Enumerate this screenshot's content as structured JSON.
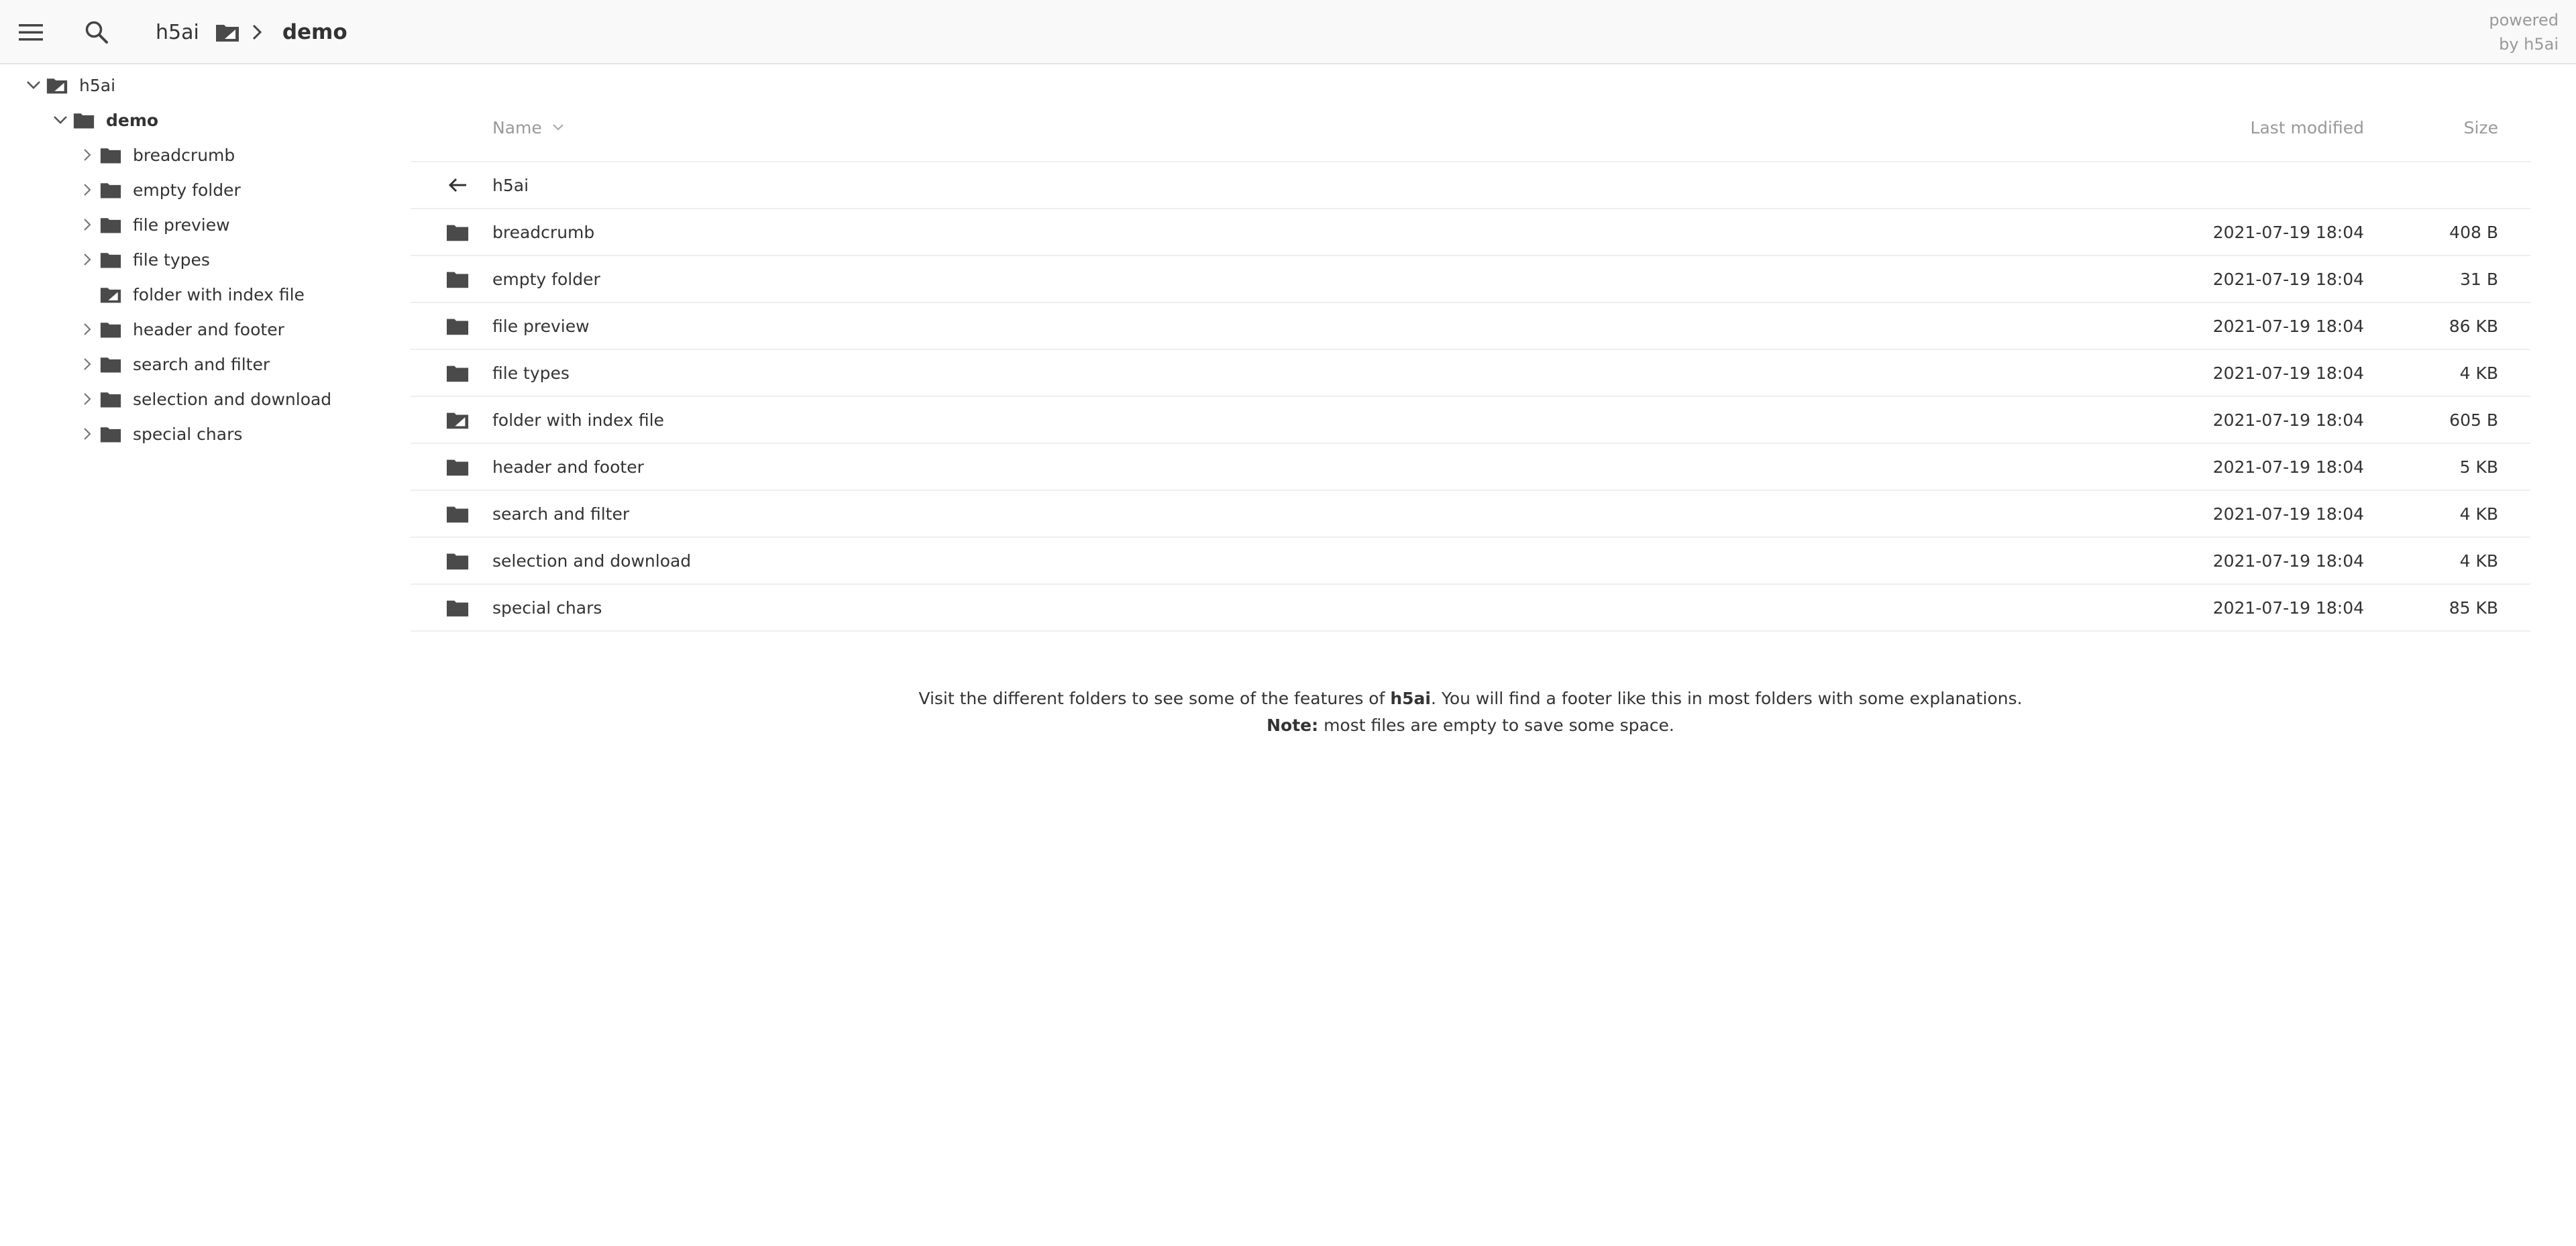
{
  "topbar": {
    "menu_icon": "hamburger-menu-icon",
    "search_icon": "search-icon",
    "breadcrumb": [
      {
        "label": "h5ai",
        "icon": "folder-with-index-icon"
      },
      {
        "label": "demo"
      }
    ],
    "powered_line1": "powered",
    "powered_line2": "by h5ai"
  },
  "tree": {
    "root": {
      "label": "h5ai",
      "icon": "folder-with-index-icon",
      "expanded": true
    },
    "current": {
      "label": "demo",
      "icon": "folder-icon",
      "expanded": true
    },
    "children": [
      {
        "label": "breadcrumb",
        "icon": "folder-icon",
        "expandable": true
      },
      {
        "label": "empty folder",
        "icon": "folder-icon",
        "expandable": true
      },
      {
        "label": "file preview",
        "icon": "folder-icon",
        "expandable": true
      },
      {
        "label": "file types",
        "icon": "folder-icon",
        "expandable": true
      },
      {
        "label": "folder with index file",
        "icon": "folder-with-index-icon",
        "expandable": false
      },
      {
        "label": "header and footer",
        "icon": "folder-icon",
        "expandable": true
      },
      {
        "label": "search and filter",
        "icon": "folder-icon",
        "expandable": true
      },
      {
        "label": "selection and download",
        "icon": "folder-icon",
        "expandable": true
      },
      {
        "label": "special chars",
        "icon": "folder-icon",
        "expandable": true
      }
    ]
  },
  "listing": {
    "headers": {
      "name": "Name",
      "modified": "Last modified",
      "size": "Size",
      "sort_icon": "chevron-down-icon"
    },
    "parent": {
      "label": "h5ai",
      "icon": "arrow-left-icon"
    },
    "rows": [
      {
        "name": "breadcrumb",
        "modified": "2021-07-19 18:04",
        "size": "408 B",
        "icon": "folder-icon"
      },
      {
        "name": "empty folder",
        "modified": "2021-07-19 18:04",
        "size": "31 B",
        "icon": "folder-icon"
      },
      {
        "name": "file preview",
        "modified": "2021-07-19 18:04",
        "size": "86 KB",
        "icon": "folder-icon"
      },
      {
        "name": "file types",
        "modified": "2021-07-19 18:04",
        "size": "4 KB",
        "icon": "folder-icon"
      },
      {
        "name": "folder with index file",
        "modified": "2021-07-19 18:04",
        "size": "605 B",
        "icon": "folder-with-index-icon"
      },
      {
        "name": "header and footer",
        "modified": "2021-07-19 18:04",
        "size": "5 KB",
        "icon": "folder-icon"
      },
      {
        "name": "search and filter",
        "modified": "2021-07-19 18:04",
        "size": "4 KB",
        "icon": "folder-icon"
      },
      {
        "name": "selection and download",
        "modified": "2021-07-19 18:04",
        "size": "4 KB",
        "icon": "folder-icon"
      },
      {
        "name": "special chars",
        "modified": "2021-07-19 18:04",
        "size": "85 KB",
        "icon": "folder-icon"
      }
    ]
  },
  "footer": {
    "line1_pre": "Visit the different folders to see some of the features of ",
    "line1_bold": "h5ai",
    "line1_post": ". You will find a footer like this in most folders with some explanations.",
    "line2_bold": "Note:",
    "line2_post": " most files are empty to save some space."
  },
  "colors": {
    "icon": "#4a4a4a",
    "text": "#333333",
    "muted": "#999999",
    "topbar_bg": "#f9f9f9",
    "divider": "#eeeeee"
  }
}
